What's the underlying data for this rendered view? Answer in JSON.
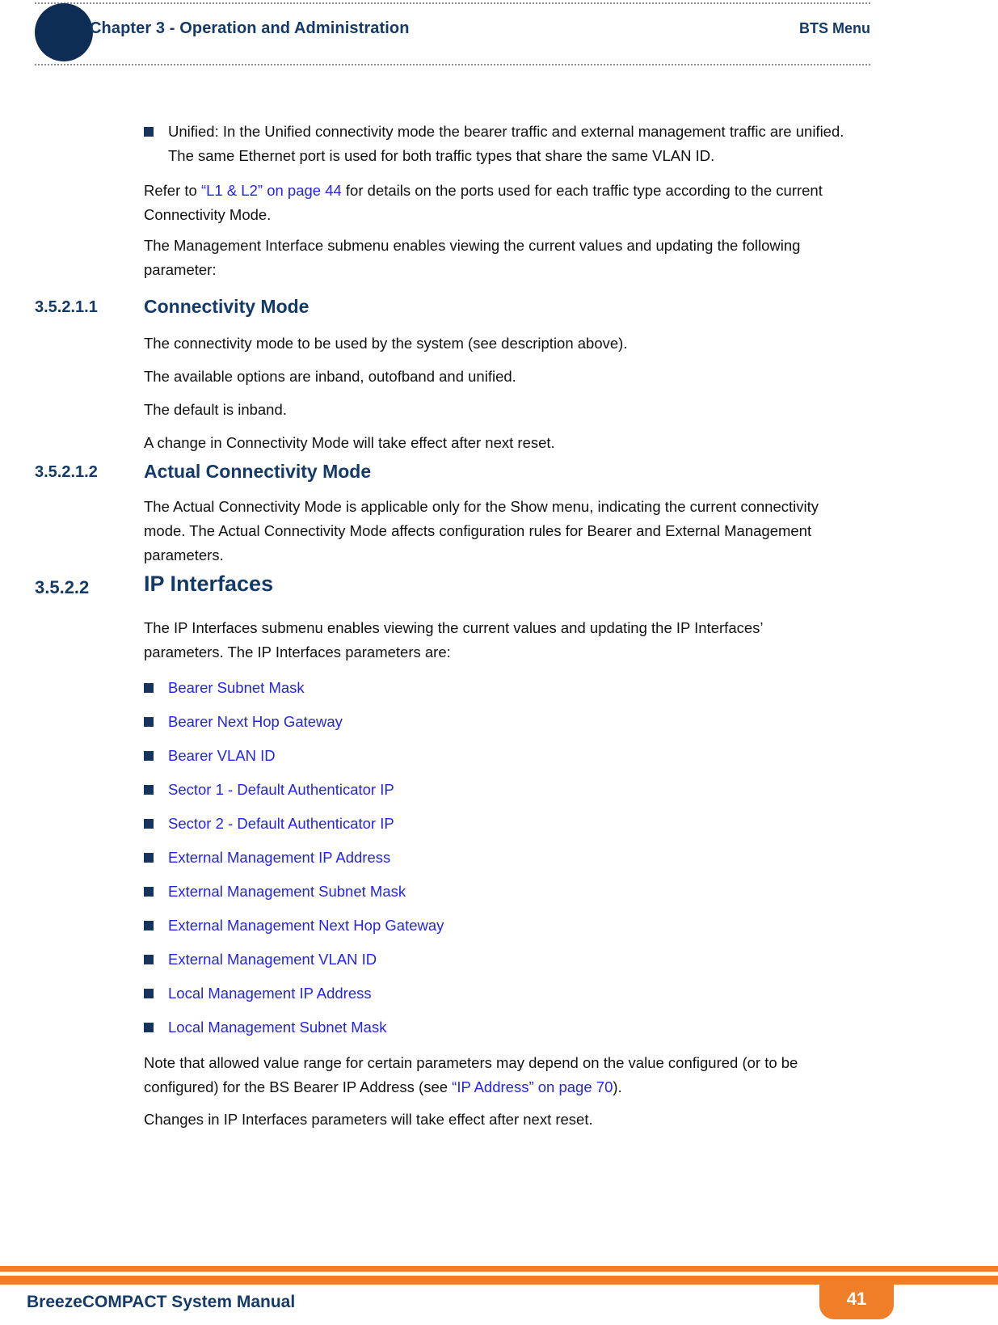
{
  "header": {
    "chapter": "Chapter 3 - Operation and Administration",
    "topic": "BTS Menu"
  },
  "body": {
    "unified_bullet": "Unified: In the Unified connectivity mode the bearer traffic and external management traffic are unified. The same Ethernet port is used for both traffic types that share the same VLAN ID.",
    "refer_pre": "Refer to ",
    "refer_link": "“L1 & L2” on page 44",
    "refer_post": " for details on the ports used for each traffic type according to the current Connectivity Mode.",
    "mgmt_intro": "The Management Interface submenu enables viewing the current values and updating the following parameter:"
  },
  "sections": [
    {
      "number": "3.5.2.1.1",
      "title": "Connectivity Mode",
      "paragraphs": [
        "The connectivity mode to be used by the system (see description above).",
        "The available options are inband, outofband and unified.",
        "The default is inband.",
        "A change in Connectivity Mode will take effect after next reset."
      ]
    },
    {
      "number": "3.5.2.1.2",
      "title": "Actual Connectivity Mode",
      "paragraphs": [
        "The Actual Connectivity Mode is applicable only for the Show menu, indicating the current connectivity mode. The Actual Connectivity Mode affects configuration rules for Bearer and External Management parameters."
      ]
    },
    {
      "number": "3.5.2.2",
      "title": "IP Interfaces",
      "paragraphs": [
        "The IP Interfaces submenu enables viewing the current values and updating the IP Interfaces’ parameters. The IP Interfaces parameters are:"
      ]
    }
  ],
  "ip_interfaces_list": [
    "Bearer Subnet Mask",
    "Bearer Next Hop Gateway",
    "Bearer VLAN ID",
    "Sector 1 - Default Authenticator IP",
    "Sector 2 - Default Authenticator IP",
    "External Management IP Address",
    "External Management Subnet Mask",
    "External Management Next Hop Gateway",
    "External Management VLAN ID",
    "Local Management IP Address",
    "Local Management Subnet Mask"
  ],
  "notes": {
    "note_pre": "Note that allowed value range for certain parameters may depend on the value configured (or to be configured) for the BS Bearer IP Address (see ",
    "note_link": "“IP Address” on page 70",
    "note_post": ").",
    "changes": "Changes in IP Interfaces parameters will take effect after next reset."
  },
  "footer": {
    "title": "BreezeCOMPACT System Manual",
    "page_number": "41"
  },
  "colors": {
    "navy": "#143a68",
    "link_blue": "#2424e8",
    "orange": "#f07d28",
    "bullet": "#16345e"
  }
}
